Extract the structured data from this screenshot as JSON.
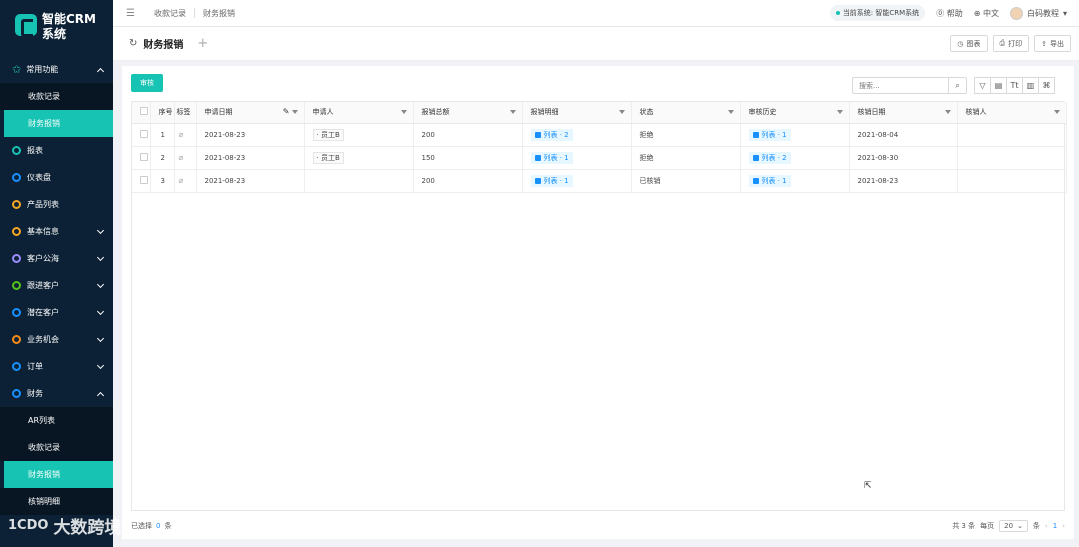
{
  "brand": {
    "name_line1": "智能CRM",
    "name_line2": "系统"
  },
  "sidebar": {
    "common": "常用功能",
    "common_sub": [
      "收款记录",
      "财务报销"
    ],
    "items": [
      {
        "label": "报表",
        "color": "#17c3b2",
        "chevron": false
      },
      {
        "label": "仪表盘",
        "color": "#1890ff",
        "chevron": false
      },
      {
        "label": "产品列表",
        "color": "#f5a623",
        "chevron": false
      },
      {
        "label": "基本信息",
        "color": "#f5a623",
        "chevron": true
      },
      {
        "label": "客户公海",
        "color": "#9b8cff",
        "chevron": true
      },
      {
        "label": "跟进客户",
        "color": "#52c41a",
        "chevron": true
      },
      {
        "label": "潜在客户",
        "color": "#1890ff",
        "chevron": true
      },
      {
        "label": "业务机会",
        "color": "#fa8c16",
        "chevron": true
      },
      {
        "label": "订单",
        "color": "#1890ff",
        "chevron": true
      },
      {
        "label": "财务",
        "color": "#1890ff",
        "chevron": true
      }
    ],
    "finance_sub": [
      "AR列表",
      "收款记录",
      "财务报销",
      "核销明细"
    ]
  },
  "topbar": {
    "tabs": [
      "收款记录",
      "财务报销"
    ],
    "current_system": "当前系统: 智能CRM系统",
    "help": "帮助",
    "language": "中文",
    "user": "白码教程"
  },
  "pagehead": {
    "title": "财务报销",
    "chart_btn": "图表",
    "print_btn": "打印",
    "export_btn": "导出"
  },
  "toolbar": {
    "approve": "审核",
    "search_placeholder": "搜索..."
  },
  "table": {
    "headers": [
      "序号",
      "标签",
      "申请日期",
      "申请人",
      "报销总额",
      "报销明细",
      "状态",
      "审核历史",
      "核销日期",
      "核销人"
    ],
    "rows": [
      {
        "no": "1",
        "date": "2021-08-23",
        "applicant": "员工B",
        "total": "200",
        "detail": "列表 · 2",
        "status": "拒绝",
        "history": "列表 · 1",
        "wo_date": "2021-08-04",
        "wo_person": ""
      },
      {
        "no": "2",
        "date": "2021-08-23",
        "applicant": "员工B",
        "total": "150",
        "detail": "列表 · 1",
        "status": "拒绝",
        "history": "列表 · 2",
        "wo_date": "2021-08-30",
        "wo_person": ""
      },
      {
        "no": "3",
        "date": "2021-08-23",
        "applicant": "",
        "total": "200",
        "detail": "列表 · 1",
        "status": "已核销",
        "history": "列表 · 1",
        "wo_date": "2021-08-23",
        "wo_person": ""
      }
    ]
  },
  "footer": {
    "selected_prefix": "已选择",
    "selected_count": "0",
    "selected_suffix": "条",
    "total": "共 3 条",
    "per_page_label": "每页",
    "page_size": "20",
    "unit": "条",
    "current_page": "1"
  },
  "watermark": {
    "logo": "1CDO",
    "text": "大数跨境"
  }
}
